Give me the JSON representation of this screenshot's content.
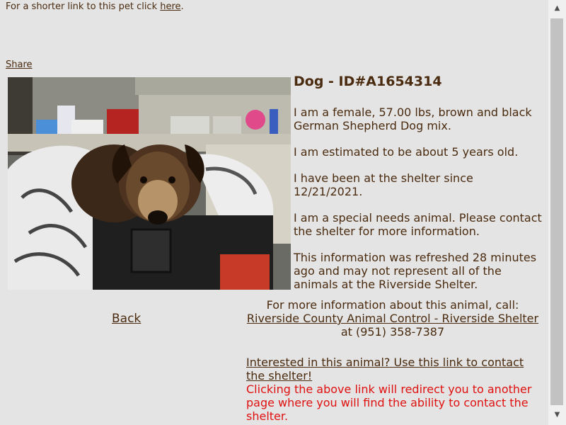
{
  "header": {
    "shortlink_text": "For a shorter link to this pet click ",
    "shortlink_link": "here",
    "shortlink_period": "."
  },
  "share_label": "Share",
  "pet": {
    "title": "Dog - ID#A1654314",
    "description": "I am a female, 57.00 lbs, brown and black German Shepherd Dog mix.",
    "age": "I am estimated to be about 5 years old.",
    "since": "I have been at the shelter since 12/21/2021.",
    "special_needs": "I am a special needs animal. Please contact the shelter for more information.",
    "refresh_note": "This information was refreshed 28 minutes ago and may not represent all of the animals at the Riverside Shelter."
  },
  "nav": {
    "back_label": "Back"
  },
  "contact": {
    "intro": "For more information about this animal, call:",
    "shelter_name": "Riverside County Animal Control - Riverside Shelter",
    "phone_text": " at (951) 358-7387"
  },
  "interest": {
    "link_text": "Interested in this animal? Use this link to contact the shelter!",
    "warning": "Clicking the above link will redirect you to another page where you will find the ability to contact the shelter."
  },
  "colors": {
    "text": "#4a2b0f",
    "warning": "#e01010",
    "background": "#e4e4e4"
  },
  "icons": {
    "scroll_up": "chevron-up-icon",
    "scroll_down": "chevron-down-icon"
  }
}
